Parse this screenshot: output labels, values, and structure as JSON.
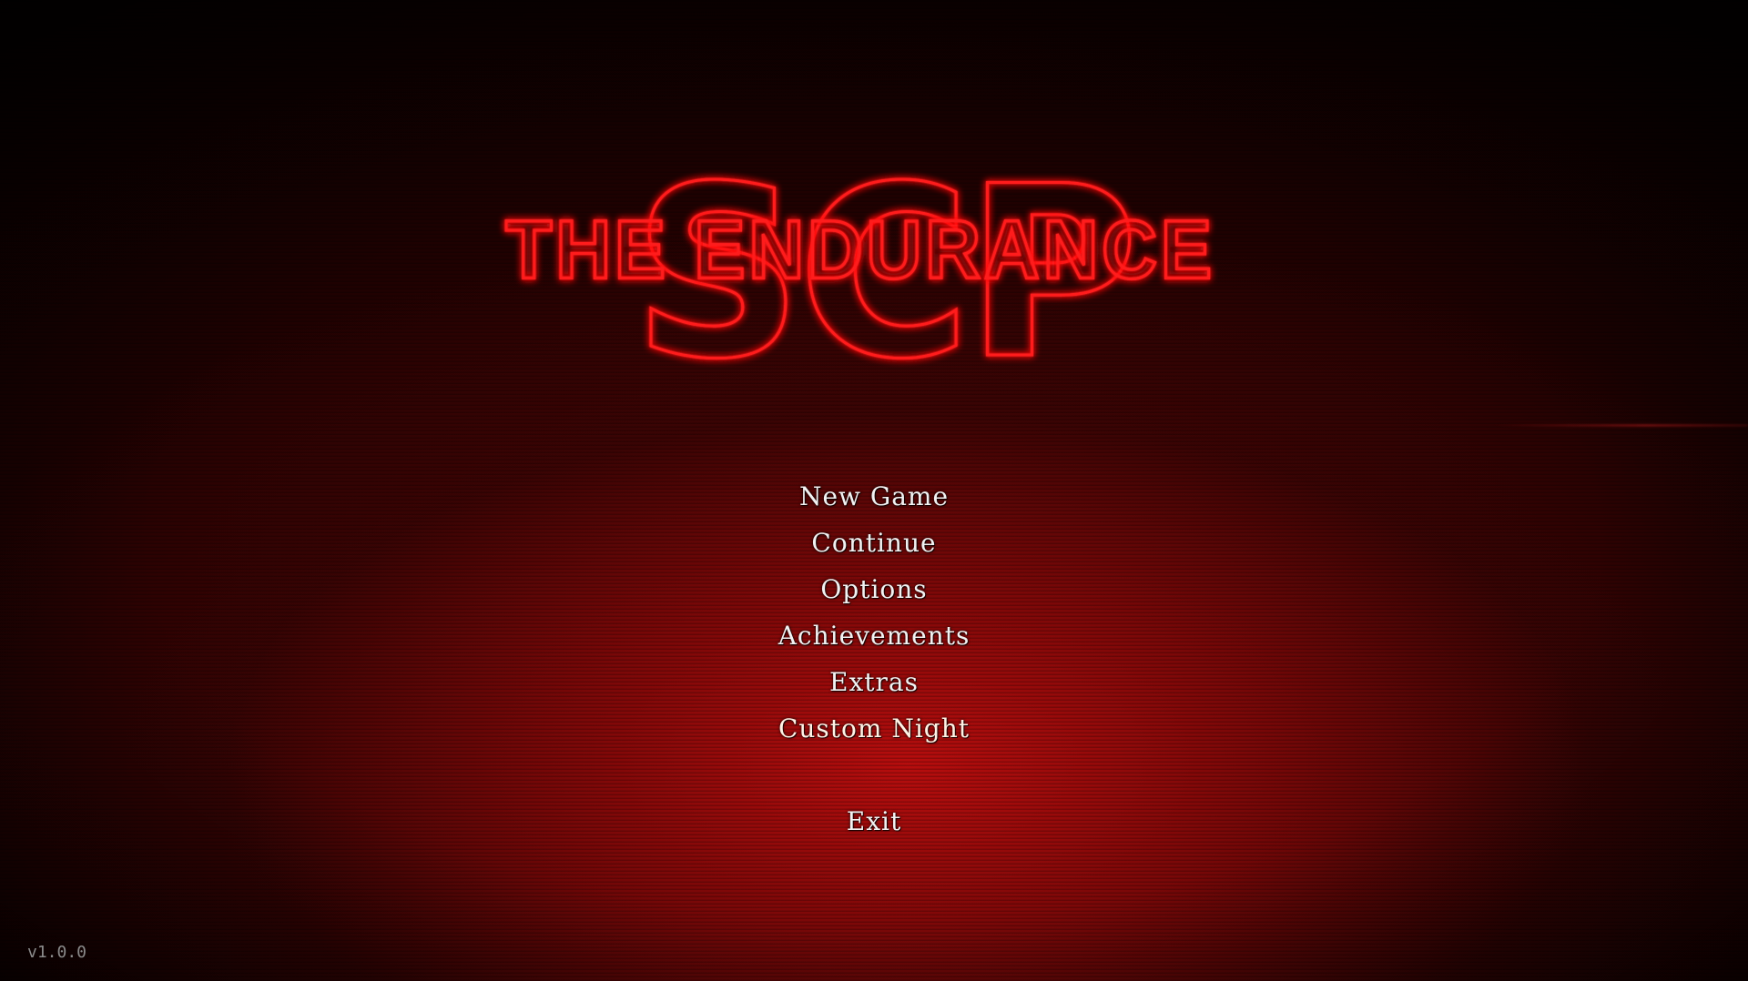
{
  "logo": {
    "main_letters": "SCP",
    "subtitle": "THE ENDURANCE"
  },
  "menu": {
    "items": [
      {
        "label": "New Game"
      },
      {
        "label": "Continue"
      },
      {
        "label": "Options"
      },
      {
        "label": "Achievements"
      },
      {
        "label": "Extras"
      },
      {
        "label": "Custom Night"
      },
      {
        "label": "Exit"
      }
    ],
    "selected": "Custom Night"
  },
  "version": "v1.0.0",
  "colors": {
    "neon": "#ff1e1e",
    "background": "#3a0303",
    "menu_text": "#f2f2f2",
    "highlight": "#ffb070"
  }
}
